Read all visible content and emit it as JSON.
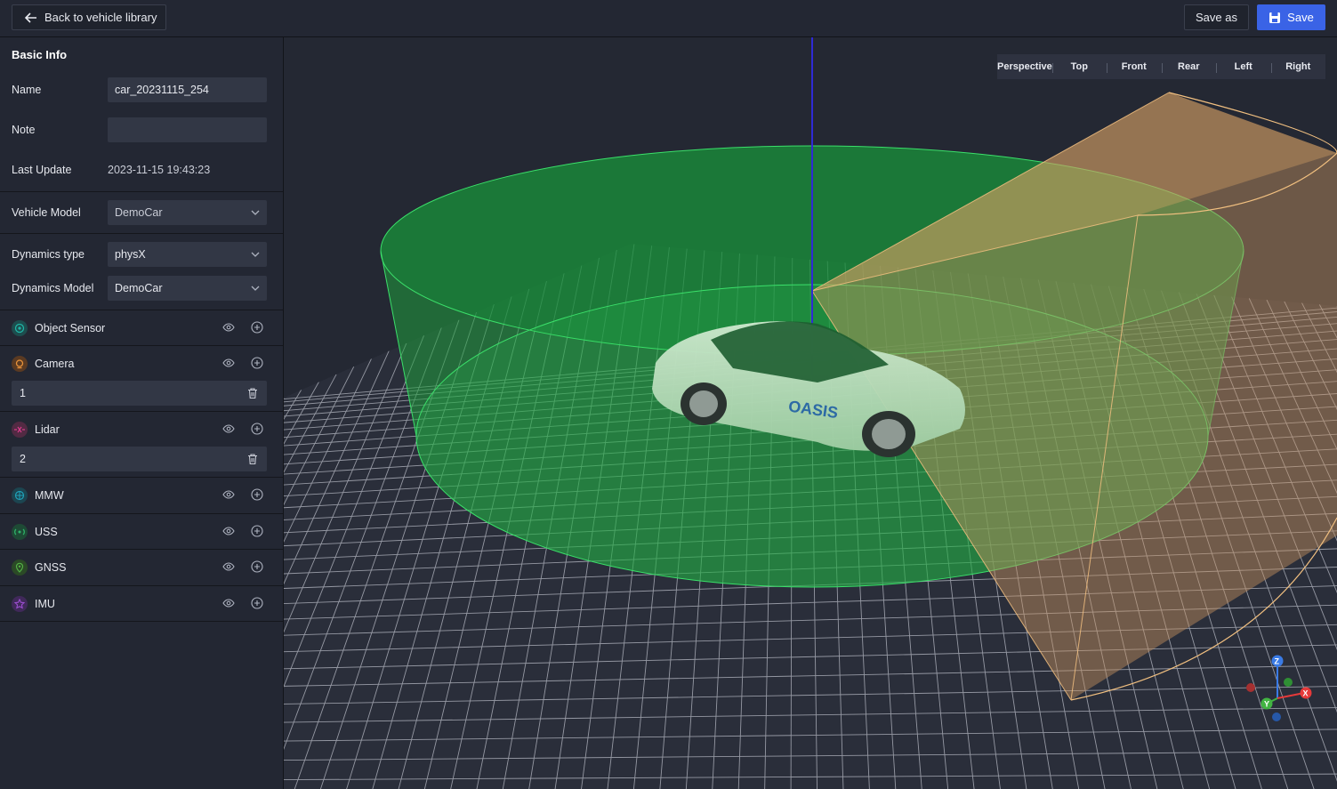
{
  "header": {
    "back_label": "Back to vehicle library",
    "save_as_label": "Save as",
    "save_label": "Save"
  },
  "basic_info": {
    "title": "Basic Info",
    "name_label": "Name",
    "name_value": "car_20231115_254",
    "note_label": "Note",
    "note_value": "",
    "last_update_label": "Last Update",
    "last_update_value": "2023-11-15 19:43:23"
  },
  "vehicle": {
    "model_label": "Vehicle Model",
    "model_value": "DemoCar"
  },
  "dynamics": {
    "type_label": "Dynamics type",
    "type_value": "physX",
    "model_label": "Dynamics Model",
    "model_value": "DemoCar"
  },
  "sensors": [
    {
      "name": "Object Sensor",
      "icon": "object-sensor-icon",
      "color": "#1fb5a6"
    },
    {
      "name": "Camera",
      "icon": "camera-icon",
      "color": "#e8923a",
      "items": [
        "1"
      ]
    },
    {
      "name": "Lidar",
      "icon": "lidar-icon",
      "color": "#d63c8a",
      "items": [
        "2"
      ]
    },
    {
      "name": "MMW",
      "icon": "mmw-icon",
      "color": "#1fa0b8"
    },
    {
      "name": "USS",
      "icon": "uss-icon",
      "color": "#2fb36a"
    },
    {
      "name": "GNSS",
      "icon": "gnss-icon",
      "color": "#53b046"
    },
    {
      "name": "IMU",
      "icon": "imu-icon",
      "color": "#9b4fd1"
    }
  ],
  "view_modes": [
    "Perspective",
    "Top",
    "Front",
    "Rear",
    "Left",
    "Right"
  ],
  "scene": {
    "car_brand_text": "OASIS",
    "axis_labels": {
      "x": "X",
      "y": "Y",
      "z": "Z"
    },
    "colors": {
      "lidar_range": "#2fd05a",
      "camera_fov": "#e0a868",
      "accent": "#3a63e6"
    }
  }
}
